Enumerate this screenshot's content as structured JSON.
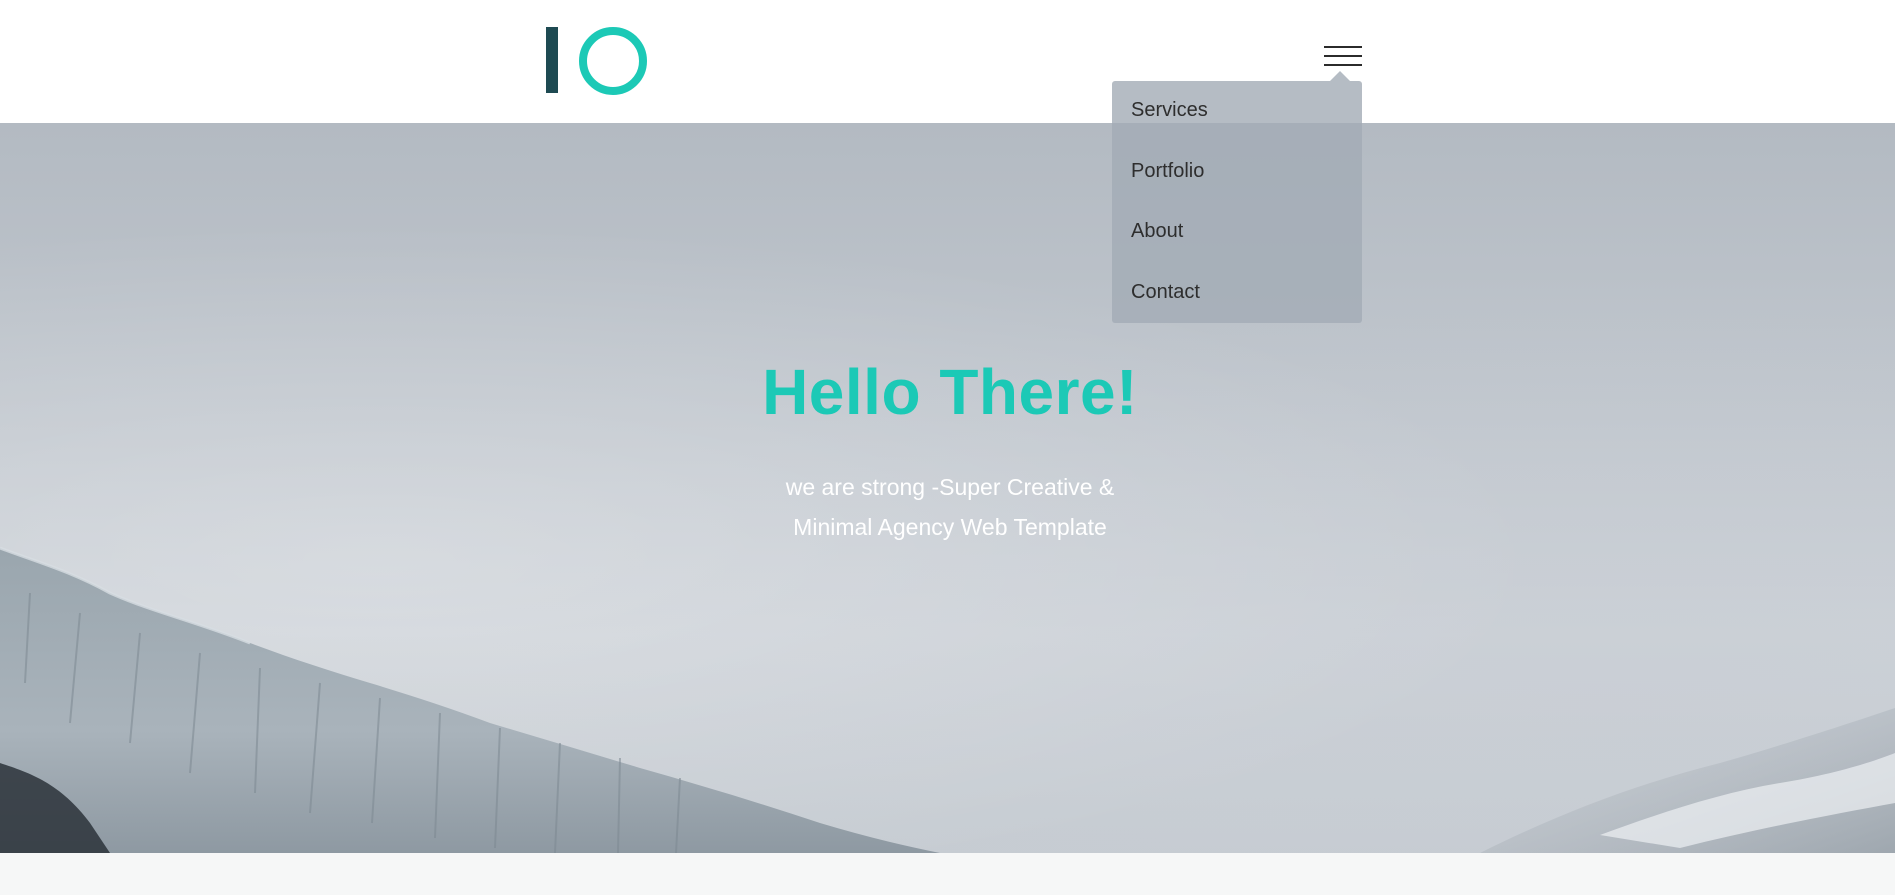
{
  "brand": {
    "logo_text": "IO",
    "colors": {
      "accent": "#1cc9b6",
      "logo_bar": "#1e4a52"
    }
  },
  "header": {
    "menu_icon": "hamburger-icon"
  },
  "nav_menu": {
    "items": [
      {
        "label": "Services"
      },
      {
        "label": "Portfolio"
      },
      {
        "label": "About"
      },
      {
        "label": "Contact"
      }
    ]
  },
  "hero": {
    "title": "Hello There!",
    "subtitle_line1": "we are strong -Super Creative &",
    "subtitle_line2": "Minimal Agency Web Template"
  }
}
